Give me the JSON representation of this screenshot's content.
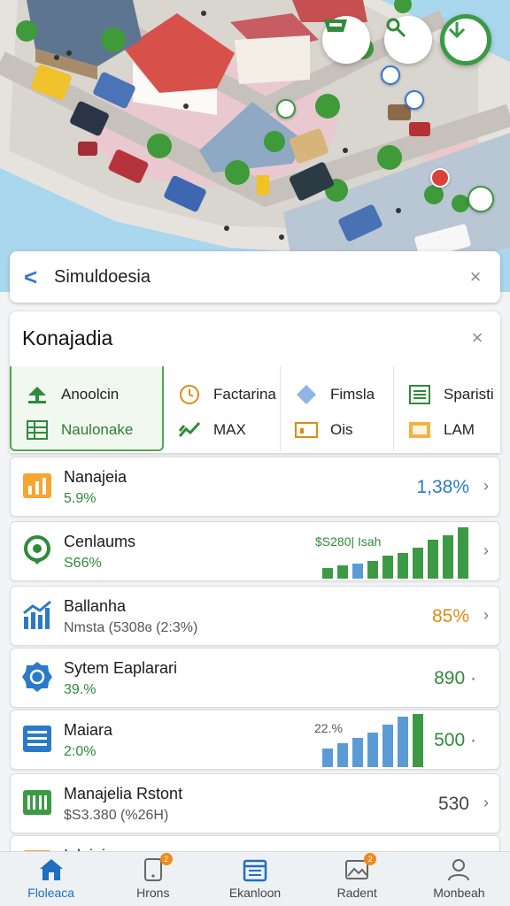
{
  "search": {
    "back_glyph": "<",
    "title": "Simuldoesia",
    "close_glyph": "×"
  },
  "panel": {
    "title": "Konajadia",
    "close_glyph": "×",
    "categories": [
      {
        "row1": {
          "icon": "tree-icon",
          "label": "Anoolcin"
        },
        "row2": {
          "icon": "grid-icon",
          "label": "Naulonake"
        },
        "active": true
      },
      {
        "row1": {
          "icon": "clock-icon",
          "label": "Factarina"
        },
        "row2": {
          "icon": "growth-icon",
          "label": "MAX"
        }
      },
      {
        "row1": {
          "icon": "diamond-icon",
          "label": "Fimsla"
        },
        "row2": {
          "icon": "panel-icon",
          "label": "Ois"
        }
      },
      {
        "row1": {
          "icon": "sheet-icon",
          "label": "Sparisti"
        },
        "row2": {
          "icon": "display-icon",
          "label": "LAM"
        }
      }
    ]
  },
  "list": [
    {
      "icon": "bar-chart-icon",
      "title": "Nanajeia",
      "subtitle": "5.9%",
      "value": "1,38%",
      "value_color": "#2a7ac9",
      "sub_color": "#2e8b3a"
    },
    {
      "icon": "location-icon",
      "title": "Cenlaums",
      "subtitle": "S66%",
      "value": "",
      "chart_label": "$S280| Isah",
      "bars": [
        0.2,
        0.25,
        0.3,
        0.35,
        0.45,
        0.5,
        0.6,
        0.75,
        0.85,
        1.0
      ],
      "value_color": "#2e8b3a",
      "sub_color": "#2e8b3a"
    },
    {
      "icon": "trend-icon",
      "title": "Ballanha",
      "subtitle": "Nmsta (5308ɞ (2:3%)",
      "value": "85%",
      "value_color": "#e08a14",
      "sub_color": "#555"
    },
    {
      "icon": "badge-icon",
      "title": "Sytem Eaplarari",
      "subtitle": "39.%",
      "value": "890 ·",
      "value_color": "#2e8b3a",
      "sub_color": "#2e8b3a"
    },
    {
      "icon": "table-icon",
      "title": "Maiara",
      "subtitle": "2:0%",
      "value": "500 ·",
      "chart_label": "22.%",
      "bars": [
        0.35,
        0.45,
        0.55,
        0.65,
        0.8,
        0.95,
        1.0
      ],
      "value_color": "#2e8b3a",
      "sub_color": "#2e8b3a"
    },
    {
      "icon": "building-icon",
      "title": "Manajelia Rstont",
      "subtitle": "$S3.380 (%26H)",
      "value": "530",
      "value_color": "#444",
      "sub_color": "#555"
    },
    {
      "icon": "folder-icon",
      "title": "Iolajeia",
      "subtitle": "",
      "value": ""
    }
  ],
  "nav": [
    {
      "icon": "home-icon",
      "label": "Floleaca",
      "active": true
    },
    {
      "icon": "phone-icon",
      "label": "Hrons",
      "badge": "2"
    },
    {
      "icon": "calendar-icon",
      "label": "Ekanloon"
    },
    {
      "icon": "image-icon",
      "label": "Radent",
      "badge": "2"
    },
    {
      "icon": "person-icon",
      "label": "Monbeah"
    }
  ],
  "colors": {
    "accent_blue": "#2f79c9",
    "accent_green": "#3a9a45",
    "accent_orange": "#e08a14"
  }
}
